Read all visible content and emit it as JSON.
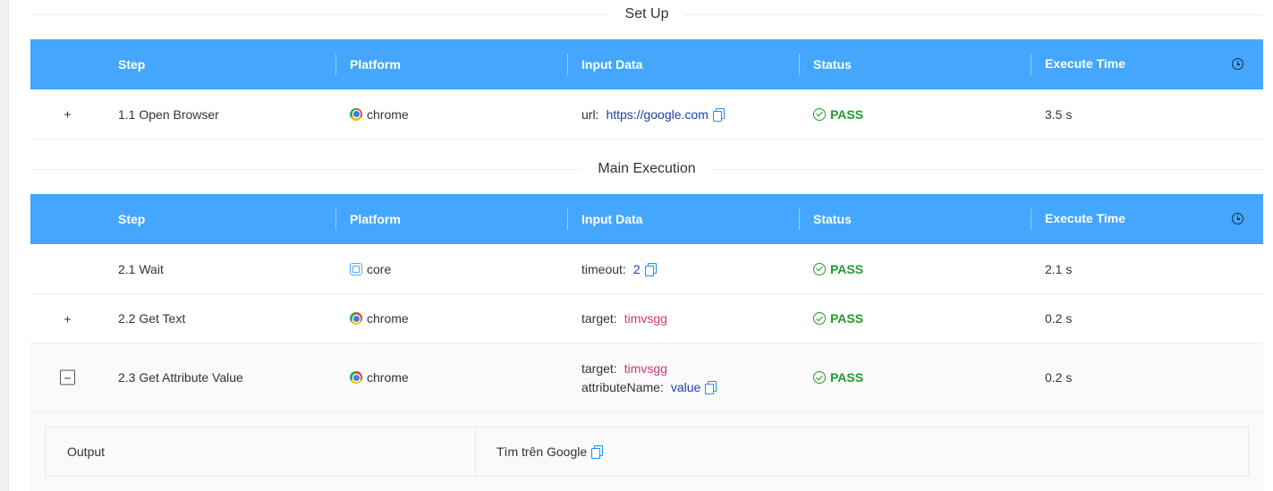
{
  "sections": {
    "setup": {
      "title": "Set Up"
    },
    "main": {
      "title": "Main Execution"
    }
  },
  "columns": {
    "step": "Step",
    "platform": "Platform",
    "input": "Input Data",
    "status": "Status",
    "time": "Execute Time"
  },
  "setup_rows": [
    {
      "expander": "+",
      "step": "1.1 Open Browser",
      "platform": "chrome",
      "platform_icon": "chrome-icon",
      "inputs": [
        {
          "key": "url:",
          "value": "https://google.com",
          "copyable": true
        }
      ],
      "status": "PASS",
      "time": "3.5 s"
    }
  ],
  "main_rows": [
    {
      "expander": "",
      "step": "2.1 Wait",
      "platform": "core",
      "platform_icon": "core-icon",
      "inputs": [
        {
          "key": "timeout:",
          "value": "2",
          "copyable": true
        }
      ],
      "status": "PASS",
      "time": "2.1 s"
    },
    {
      "expander": "+",
      "step": "2.2 Get Text",
      "platform": "chrome",
      "platform_icon": "chrome-icon",
      "inputs": [
        {
          "key": "target:",
          "value": "timvsgg",
          "copyable": false
        }
      ],
      "status": "PASS",
      "time": "0.2 s"
    },
    {
      "expander": "−",
      "step": "2.3 Get Attribute Value",
      "platform": "chrome",
      "platform_icon": "chrome-icon",
      "inputs": [
        {
          "key": "target:",
          "value": "timvsgg",
          "copyable": false
        },
        {
          "key": "attributeName:",
          "value": "value",
          "copyable": true
        }
      ],
      "status": "PASS",
      "time": "0.2 s"
    }
  ],
  "output": {
    "label": "Output",
    "value": "Tìm trên Google"
  },
  "colors": {
    "header_bg": "#44a6fc",
    "pass": "#1f9d2a",
    "link": "#1a3fa8",
    "target": "#d6337a",
    "copy_icon": "#1e8ff5"
  }
}
